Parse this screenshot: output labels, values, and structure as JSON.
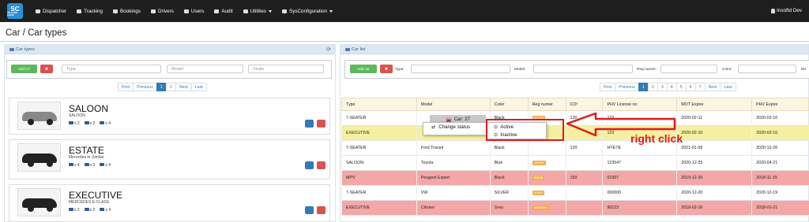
{
  "app": {
    "logo": "SC",
    "logo_sub": "SKYLINE CARS"
  },
  "nav": [
    {
      "label": "Dispatcher",
      "dropdown": false
    },
    {
      "label": "Tracking",
      "dropdown": false
    },
    {
      "label": "Bookings",
      "dropdown": false
    },
    {
      "label": "Drivers",
      "dropdown": false
    },
    {
      "label": "Users",
      "dropdown": false
    },
    {
      "label": "Audit",
      "dropdown": false
    },
    {
      "label": "Utilities",
      "dropdown": true
    },
    {
      "label": "SysConfiguration",
      "dropdown": true
    }
  ],
  "user": "Insoftd Dev",
  "breadcrumb": "Car / Car types",
  "car_types_panel": {
    "title": "Car types",
    "add_label": "Add CT",
    "filters": {
      "type_placeholder": "Type",
      "model_placeholder": "Model",
      "seats_placeholder": "Seats"
    },
    "pager": [
      "First",
      "Previous",
      "1",
      "2",
      "Next",
      "Last"
    ],
    "active_page": "1",
    "cards": [
      {
        "title": "SALOON",
        "subtitle": "SALOON",
        "suitcases": "x 2",
        "bags": "x 2",
        "seats": "x 4"
      },
      {
        "title": "ESTATE",
        "subtitle": "Mercedes or Similar",
        "suitcases": "x 4",
        "bags": "x 3",
        "seats": "x 4"
      },
      {
        "title": "EXECUTIVE",
        "subtitle": "MERCEDES E-CLASS",
        "suitcases": "x 2",
        "bags": "x 2",
        "seats": "x 4"
      }
    ]
  },
  "car_list_panel": {
    "title": "Car list",
    "add_label": "Add car",
    "filters": {
      "type_label": "Type:",
      "model_label": "Model:",
      "reg_label": "Reg numer:",
      "color_label": "Color:",
      "last_label": "Ett"
    },
    "pager": [
      "First",
      "Previous",
      "1",
      "2",
      "3",
      "4",
      "5",
      "6",
      "7",
      "Next",
      "Last"
    ],
    "active_page": "1",
    "columns": [
      "Type",
      "Model",
      "Color",
      "Reg numer",
      "CO²",
      "PHV License no",
      "MOT Expire",
      "PHV Expire"
    ],
    "rows": [
      {
        "type": "7-SEATER",
        "model": "",
        "color": "Black",
        "reg": "HD 0HS",
        "co2": "130",
        "phv": "123",
        "mot": "2020-02-11",
        "phv_exp": "2020-02-10",
        "style": "plain"
      },
      {
        "type": "EXECUTIVE",
        "model": "",
        "color": "",
        "reg": "",
        "co2": "",
        "phv": "123",
        "mot": "2020-02-10",
        "phv_exp": "2020-02-10",
        "style": "yellow"
      },
      {
        "type": "7-SEATER",
        "model": "Ford Transit",
        "color": "Black",
        "reg": "",
        "co2": "120",
        "phv": "HYETE",
        "mot": "2021-01-09",
        "phv_exp": "2020-12-26",
        "style": "plain"
      },
      {
        "type": "SALOON",
        "model": "Toyota",
        "color": "Blue",
        "reg": "VAPRBL",
        "co2": "",
        "phv": "123547",
        "mot": "2020-12-25",
        "phv_exp": "2020-04-21",
        "style": "plain"
      },
      {
        "type": "MPV",
        "model": "Peugeot Expert",
        "color": "Black",
        "reg": "BHA8B",
        "co2": "150",
        "phv": "01007",
        "mot": "2019-12-20",
        "phv_exp": "2018-11-15",
        "style": "red"
      },
      {
        "type": "7-SEATER",
        "model": "VW",
        "color": "SILVER",
        "reg": "DHA0X",
        "co2": "",
        "phv": "000000",
        "mot": "2020-12-20",
        "phv_exp": "2020-12-19",
        "style": "plain"
      },
      {
        "type": "EXECUTIVE",
        "model": "Citroen",
        "color": "Grey",
        "reg": "VO00 SVH",
        "co2": "",
        "phv": "90123",
        "mot": "2018-02-16",
        "phv_exp": "2018-01-21",
        "style": "red"
      }
    ]
  },
  "context_menu": {
    "header": "Car: 27",
    "change_status": "Change status",
    "active": "Active",
    "inactive": "Inactive"
  },
  "annotation": {
    "text": "right click",
    "color": "#e01a1a"
  },
  "colors": {
    "topbar": "#1e1e1e",
    "accent": "#337ab7",
    "yellow_row": "#f5f0a1",
    "red_row": "#f3a7a7"
  }
}
